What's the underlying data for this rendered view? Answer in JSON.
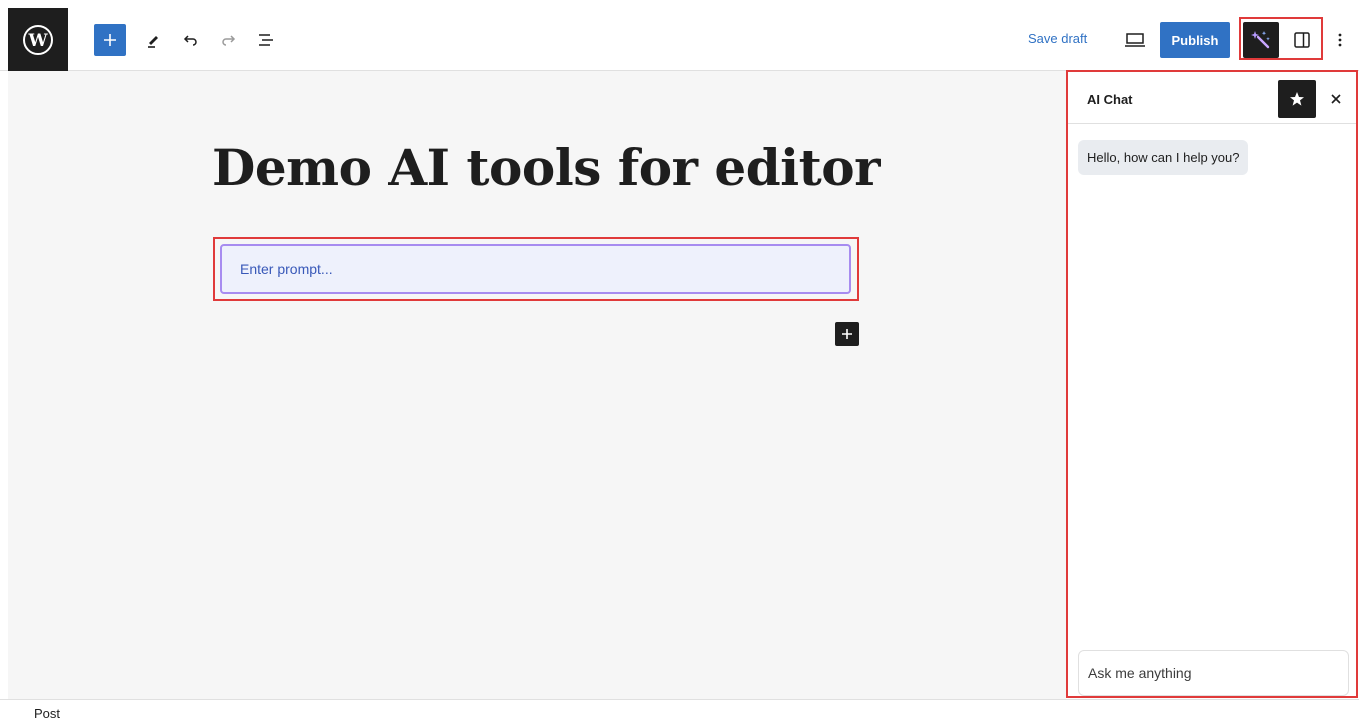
{
  "toolbar": {
    "save_draft_label": "Save draft",
    "publish_label": "Publish"
  },
  "editor": {
    "post_title": "Demo AI tools for editor",
    "prompt_placeholder": "Enter prompt..."
  },
  "chat": {
    "title": "AI Chat",
    "messages": [
      {
        "role": "assistant",
        "text": "Hello, how can I help you?"
      }
    ],
    "input_placeholder": "Ask me anything"
  },
  "footer": {
    "breadcrumb": "Post"
  },
  "colors": {
    "accent": "#3072c4",
    "highlight": "#e03a3a",
    "ai_gradient": "#a78cf0"
  },
  "icons": [
    "wordpress-logo",
    "plus-icon",
    "pencil-icon",
    "undo-icon",
    "redo-icon",
    "list-view-icon",
    "desktop-preview-icon",
    "ai-magic-wand-icon",
    "sidebar-panel-icon",
    "more-options-icon",
    "star-icon",
    "close-icon"
  ]
}
